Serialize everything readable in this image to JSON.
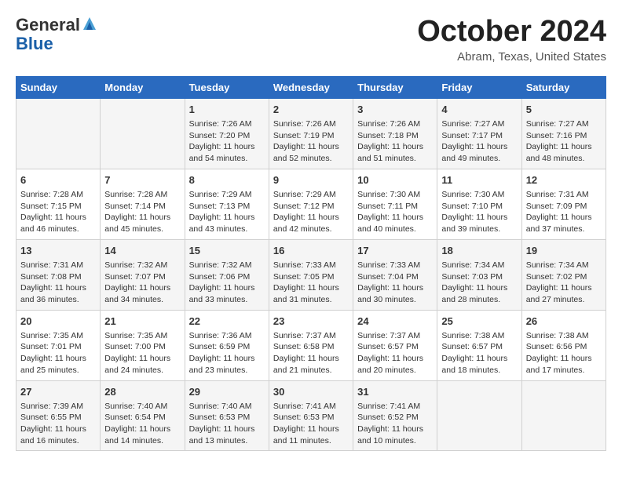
{
  "header": {
    "logo_general": "General",
    "logo_blue": "Blue",
    "month_title": "October 2024",
    "location": "Abram, Texas, United States"
  },
  "days_of_week": [
    "Sunday",
    "Monday",
    "Tuesday",
    "Wednesday",
    "Thursday",
    "Friday",
    "Saturday"
  ],
  "weeks": [
    [
      {
        "day": "",
        "content": ""
      },
      {
        "day": "",
        "content": ""
      },
      {
        "day": "1",
        "content": "Sunrise: 7:26 AM\nSunset: 7:20 PM\nDaylight: 11 hours and 54 minutes."
      },
      {
        "day": "2",
        "content": "Sunrise: 7:26 AM\nSunset: 7:19 PM\nDaylight: 11 hours and 52 minutes."
      },
      {
        "day": "3",
        "content": "Sunrise: 7:26 AM\nSunset: 7:18 PM\nDaylight: 11 hours and 51 minutes."
      },
      {
        "day": "4",
        "content": "Sunrise: 7:27 AM\nSunset: 7:17 PM\nDaylight: 11 hours and 49 minutes."
      },
      {
        "day": "5",
        "content": "Sunrise: 7:27 AM\nSunset: 7:16 PM\nDaylight: 11 hours and 48 minutes."
      }
    ],
    [
      {
        "day": "6",
        "content": "Sunrise: 7:28 AM\nSunset: 7:15 PM\nDaylight: 11 hours and 46 minutes."
      },
      {
        "day": "7",
        "content": "Sunrise: 7:28 AM\nSunset: 7:14 PM\nDaylight: 11 hours and 45 minutes."
      },
      {
        "day": "8",
        "content": "Sunrise: 7:29 AM\nSunset: 7:13 PM\nDaylight: 11 hours and 43 minutes."
      },
      {
        "day": "9",
        "content": "Sunrise: 7:29 AM\nSunset: 7:12 PM\nDaylight: 11 hours and 42 minutes."
      },
      {
        "day": "10",
        "content": "Sunrise: 7:30 AM\nSunset: 7:11 PM\nDaylight: 11 hours and 40 minutes."
      },
      {
        "day": "11",
        "content": "Sunrise: 7:30 AM\nSunset: 7:10 PM\nDaylight: 11 hours and 39 minutes."
      },
      {
        "day": "12",
        "content": "Sunrise: 7:31 AM\nSunset: 7:09 PM\nDaylight: 11 hours and 37 minutes."
      }
    ],
    [
      {
        "day": "13",
        "content": "Sunrise: 7:31 AM\nSunset: 7:08 PM\nDaylight: 11 hours and 36 minutes."
      },
      {
        "day": "14",
        "content": "Sunrise: 7:32 AM\nSunset: 7:07 PM\nDaylight: 11 hours and 34 minutes."
      },
      {
        "day": "15",
        "content": "Sunrise: 7:32 AM\nSunset: 7:06 PM\nDaylight: 11 hours and 33 minutes."
      },
      {
        "day": "16",
        "content": "Sunrise: 7:33 AM\nSunset: 7:05 PM\nDaylight: 11 hours and 31 minutes."
      },
      {
        "day": "17",
        "content": "Sunrise: 7:33 AM\nSunset: 7:04 PM\nDaylight: 11 hours and 30 minutes."
      },
      {
        "day": "18",
        "content": "Sunrise: 7:34 AM\nSunset: 7:03 PM\nDaylight: 11 hours and 28 minutes."
      },
      {
        "day": "19",
        "content": "Sunrise: 7:34 AM\nSunset: 7:02 PM\nDaylight: 11 hours and 27 minutes."
      }
    ],
    [
      {
        "day": "20",
        "content": "Sunrise: 7:35 AM\nSunset: 7:01 PM\nDaylight: 11 hours and 25 minutes."
      },
      {
        "day": "21",
        "content": "Sunrise: 7:35 AM\nSunset: 7:00 PM\nDaylight: 11 hours and 24 minutes."
      },
      {
        "day": "22",
        "content": "Sunrise: 7:36 AM\nSunset: 6:59 PM\nDaylight: 11 hours and 23 minutes."
      },
      {
        "day": "23",
        "content": "Sunrise: 7:37 AM\nSunset: 6:58 PM\nDaylight: 11 hours and 21 minutes."
      },
      {
        "day": "24",
        "content": "Sunrise: 7:37 AM\nSunset: 6:57 PM\nDaylight: 11 hours and 20 minutes."
      },
      {
        "day": "25",
        "content": "Sunrise: 7:38 AM\nSunset: 6:57 PM\nDaylight: 11 hours and 18 minutes."
      },
      {
        "day": "26",
        "content": "Sunrise: 7:38 AM\nSunset: 6:56 PM\nDaylight: 11 hours and 17 minutes."
      }
    ],
    [
      {
        "day": "27",
        "content": "Sunrise: 7:39 AM\nSunset: 6:55 PM\nDaylight: 11 hours and 16 minutes."
      },
      {
        "day": "28",
        "content": "Sunrise: 7:40 AM\nSunset: 6:54 PM\nDaylight: 11 hours and 14 minutes."
      },
      {
        "day": "29",
        "content": "Sunrise: 7:40 AM\nSunset: 6:53 PM\nDaylight: 11 hours and 13 minutes."
      },
      {
        "day": "30",
        "content": "Sunrise: 7:41 AM\nSunset: 6:53 PM\nDaylight: 11 hours and 11 minutes."
      },
      {
        "day": "31",
        "content": "Sunrise: 7:41 AM\nSunset: 6:52 PM\nDaylight: 11 hours and 10 minutes."
      },
      {
        "day": "",
        "content": ""
      },
      {
        "day": "",
        "content": ""
      }
    ]
  ]
}
